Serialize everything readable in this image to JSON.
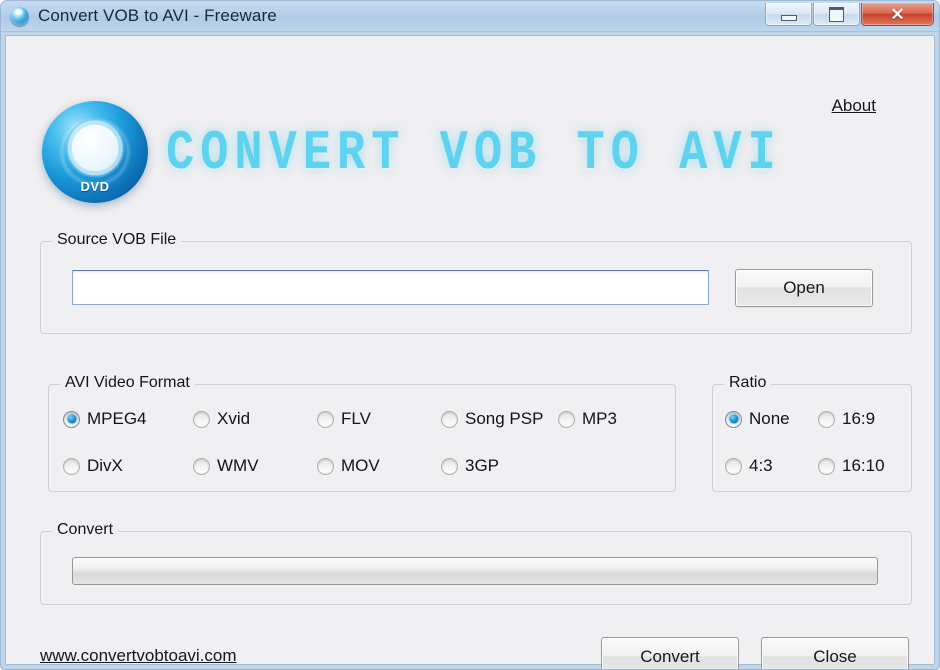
{
  "window": {
    "title": "Convert VOB to AVI - Freeware",
    "app_icon": "blue-orb-icon",
    "controls": {
      "minimize": "minimize-icon",
      "maximize": "maximize-icon",
      "close": "✕"
    }
  },
  "header": {
    "logo_icon": "dvd-disc-icon",
    "logo_disc_text": "DVD",
    "wordmark": "CONVERT VOB TO AVI",
    "wordmark_color": "#5fd2ef",
    "about_label": "About"
  },
  "source": {
    "group_title": "Source VOB File",
    "input_value": "",
    "input_placeholder": "",
    "open_label": "Open"
  },
  "format": {
    "group_title": "AVI Video Format",
    "selected": "MPEG4",
    "options": [
      {
        "label": "MPEG4",
        "checked": true
      },
      {
        "label": "Xvid",
        "checked": false
      },
      {
        "label": "FLV",
        "checked": false
      },
      {
        "label": "Song PSP",
        "checked": false
      },
      {
        "label": "MP3",
        "checked": false
      },
      {
        "label": "DivX",
        "checked": false
      },
      {
        "label": "WMV",
        "checked": false
      },
      {
        "label": "MOV",
        "checked": false
      },
      {
        "label": "3GP",
        "checked": false
      }
    ]
  },
  "ratio": {
    "group_title": "Ratio",
    "selected": "None",
    "options": [
      {
        "label": "None",
        "checked": true
      },
      {
        "label": "16:9",
        "checked": false
      },
      {
        "label": "4:3",
        "checked": false
      },
      {
        "label": "16:10",
        "checked": false
      }
    ]
  },
  "convert": {
    "group_title": "Convert",
    "progress_percent": 0
  },
  "footer": {
    "site_url": "www.convertvobtoavi.com",
    "convert_label": "Convert",
    "close_label": "Close"
  }
}
